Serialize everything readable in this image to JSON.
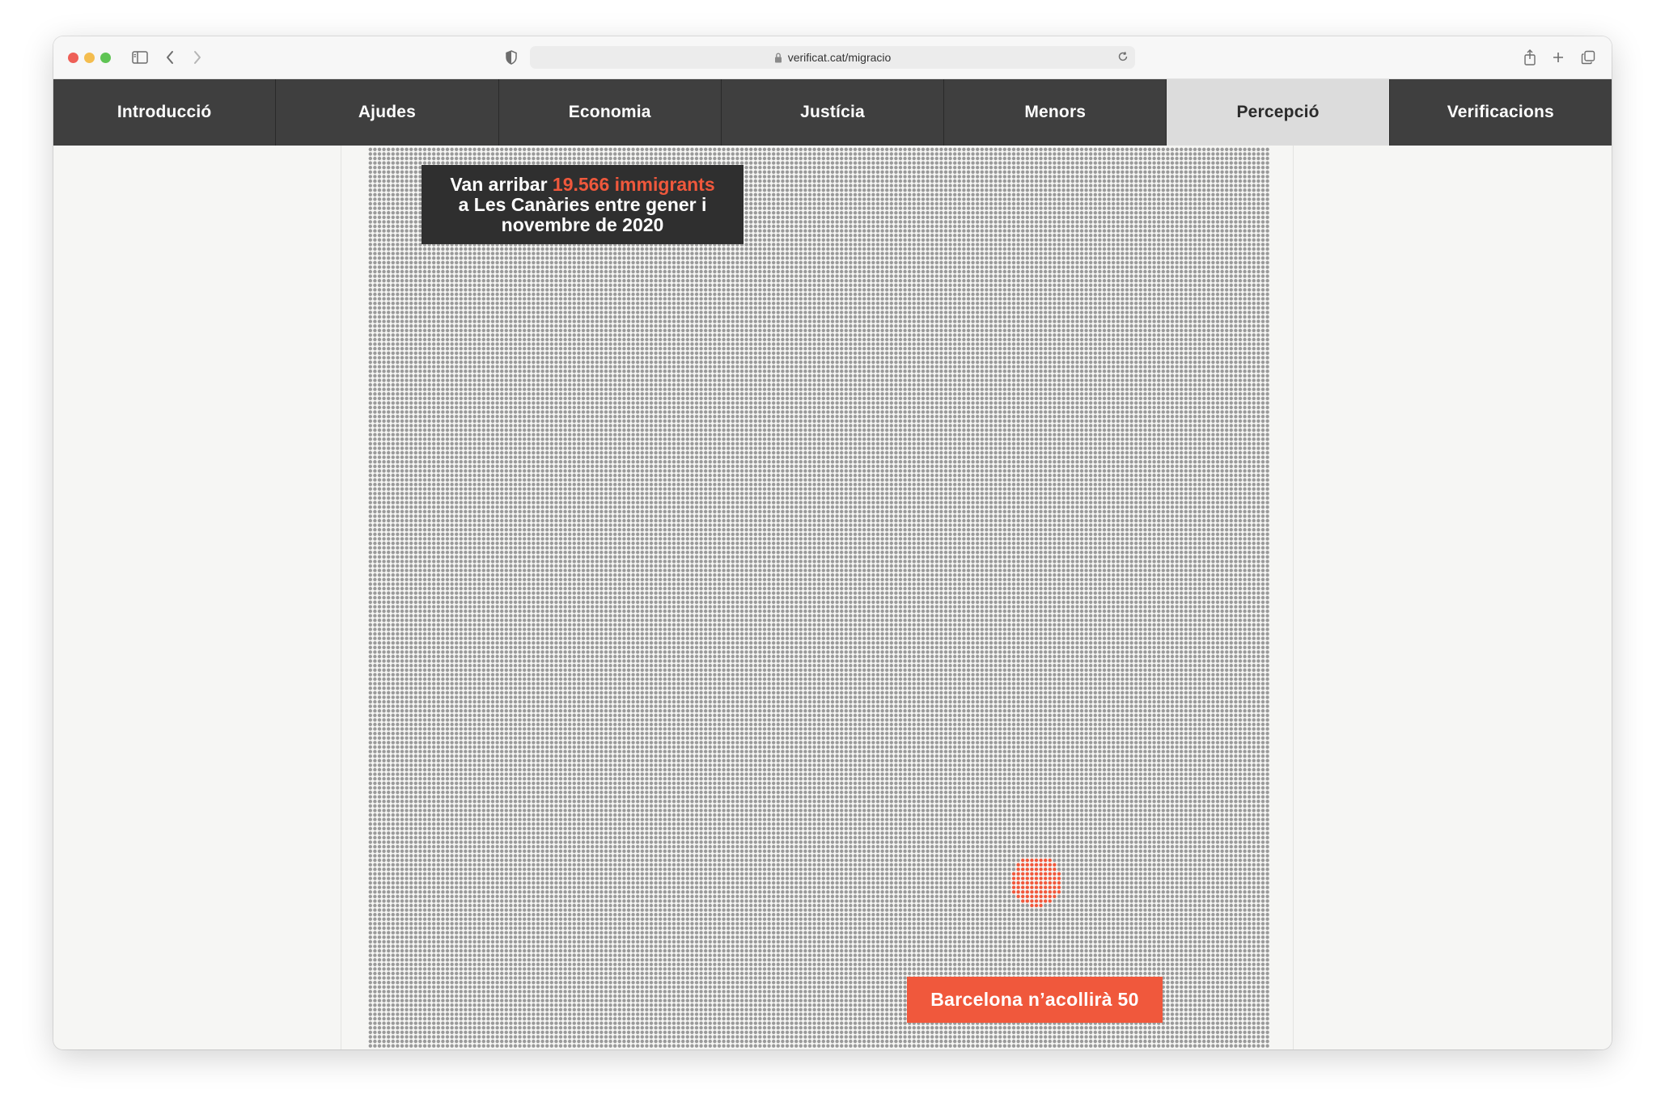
{
  "browser": {
    "url": "verificat.cat/migracio"
  },
  "nav": {
    "tabs": [
      {
        "label": "Introducció",
        "active": false
      },
      {
        "label": "Ajudes",
        "active": false
      },
      {
        "label": "Economia",
        "active": false
      },
      {
        "label": "Justícia",
        "active": false
      },
      {
        "label": "Menors",
        "active": false
      },
      {
        "label": "Percepció",
        "active": true
      },
      {
        "label": "Verificacions",
        "active": false
      }
    ]
  },
  "callout": {
    "prefix": "Van arribar ",
    "highlight": "19.566 immigrants",
    "line2": "a Les Canàries entre gener i",
    "line3": "novembre de 2020"
  },
  "badge": {
    "label": "Barcelona n’acollirà 50"
  },
  "colors": {
    "accent": "#f0583c",
    "dot": "#9a9a9a",
    "nav_bg": "#3f3f3f",
    "nav_active_bg": "#dcdcdc",
    "callout_bg": "#2f2f2f"
  },
  "icons": [
    "sidebar-toggle-icon",
    "back-chevron-icon",
    "forward-chevron-icon",
    "shield-icon",
    "lock-icon",
    "reload-icon",
    "share-icon",
    "new-tab-plus-icon",
    "tabs-overview-icon"
  ]
}
